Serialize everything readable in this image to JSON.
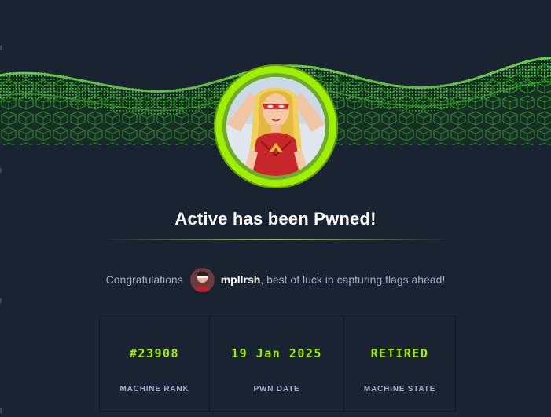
{
  "title": "Active has been Pwned!",
  "congrats": {
    "prefix": "Congratulations",
    "username": "mpllrsh",
    "suffix": ", best of luck in capturing flags ahead!"
  },
  "stats": [
    {
      "value": "#23908",
      "label": "MACHINE RANK"
    },
    {
      "value": "19 Jan 2025",
      "label": "PWN DATE"
    },
    {
      "value": "RETIRED",
      "label": "MACHINE STATE"
    }
  ],
  "colors": {
    "background": "#1a2332",
    "accent": "#9fef00",
    "muted_text": "#a4b1cd",
    "heading": "#ffffff"
  },
  "icons": {
    "machine_avatar": "machine-avatar-icon",
    "user_avatar": "user-avatar-icon"
  }
}
